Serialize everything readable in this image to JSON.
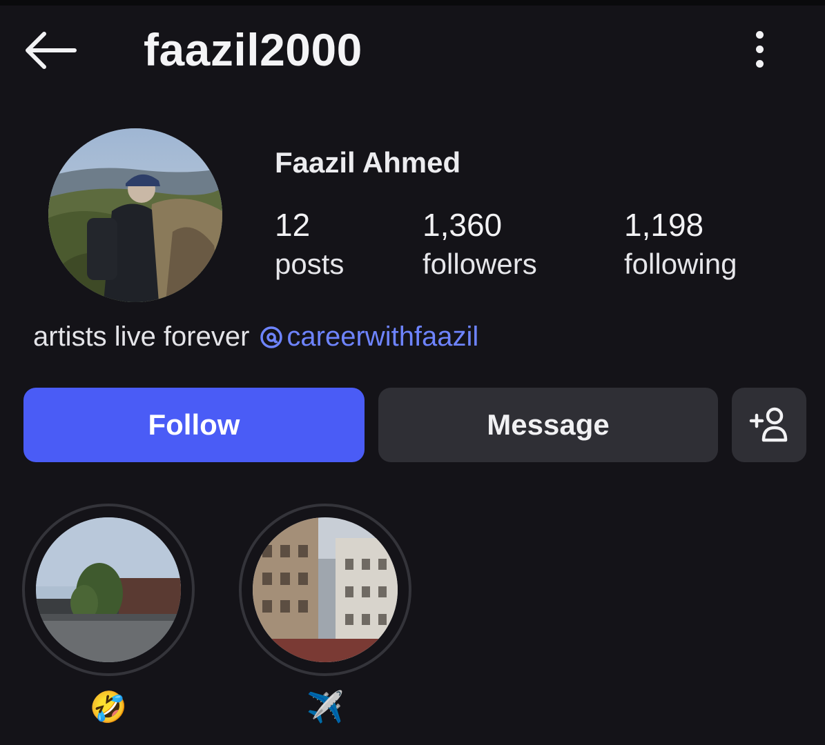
{
  "header": {
    "username": "faazil2000",
    "back_icon": "arrow-left-icon",
    "more_icon": "more-vertical-icon"
  },
  "profile": {
    "full_name": "Faazil Ahmed",
    "stats": {
      "posts_value": "12",
      "posts_label": "posts",
      "followers_value": "1,360",
      "followers_label": "followers",
      "following_value": "1,198",
      "following_label": "following"
    },
    "bio": {
      "text": "artists live forever",
      "link_text": "careerwithfaazil",
      "link_icon": "threads-icon"
    }
  },
  "actions": {
    "follow_label": "Follow",
    "message_label": "Message",
    "suggest_icon": "add-person-icon"
  },
  "highlights": [
    {
      "label": "🤣"
    },
    {
      "label": "✈️"
    }
  ],
  "colors": {
    "background": "#141318",
    "follow_button": "#4a5cf6",
    "secondary_button": "#2f2f35",
    "link": "#6e84ff"
  }
}
